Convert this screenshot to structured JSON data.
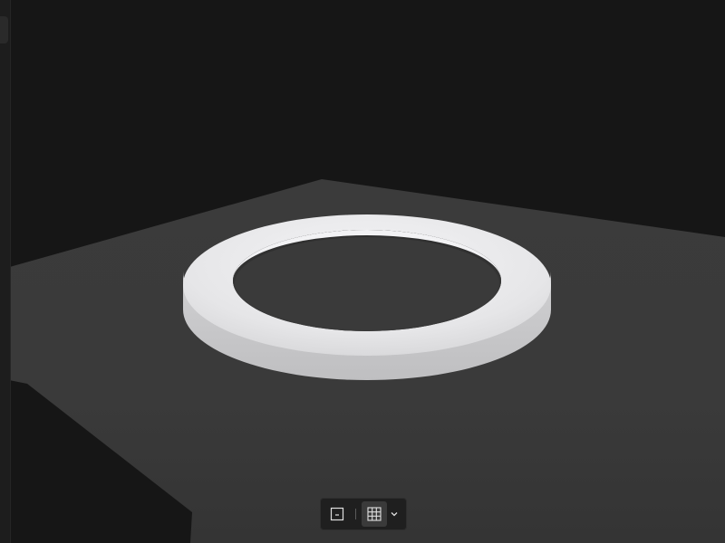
{
  "viewport": {
    "background_color": "#161616",
    "ground_color": "#3a3a3a",
    "ring_color": "#e8e8ea"
  },
  "toolbar": {
    "buttons": [
      {
        "icon": "single-view-icon",
        "active": false
      },
      {
        "icon": "grid-view-icon",
        "active": true
      }
    ],
    "dropdown_icon": "chevron-down-icon"
  }
}
